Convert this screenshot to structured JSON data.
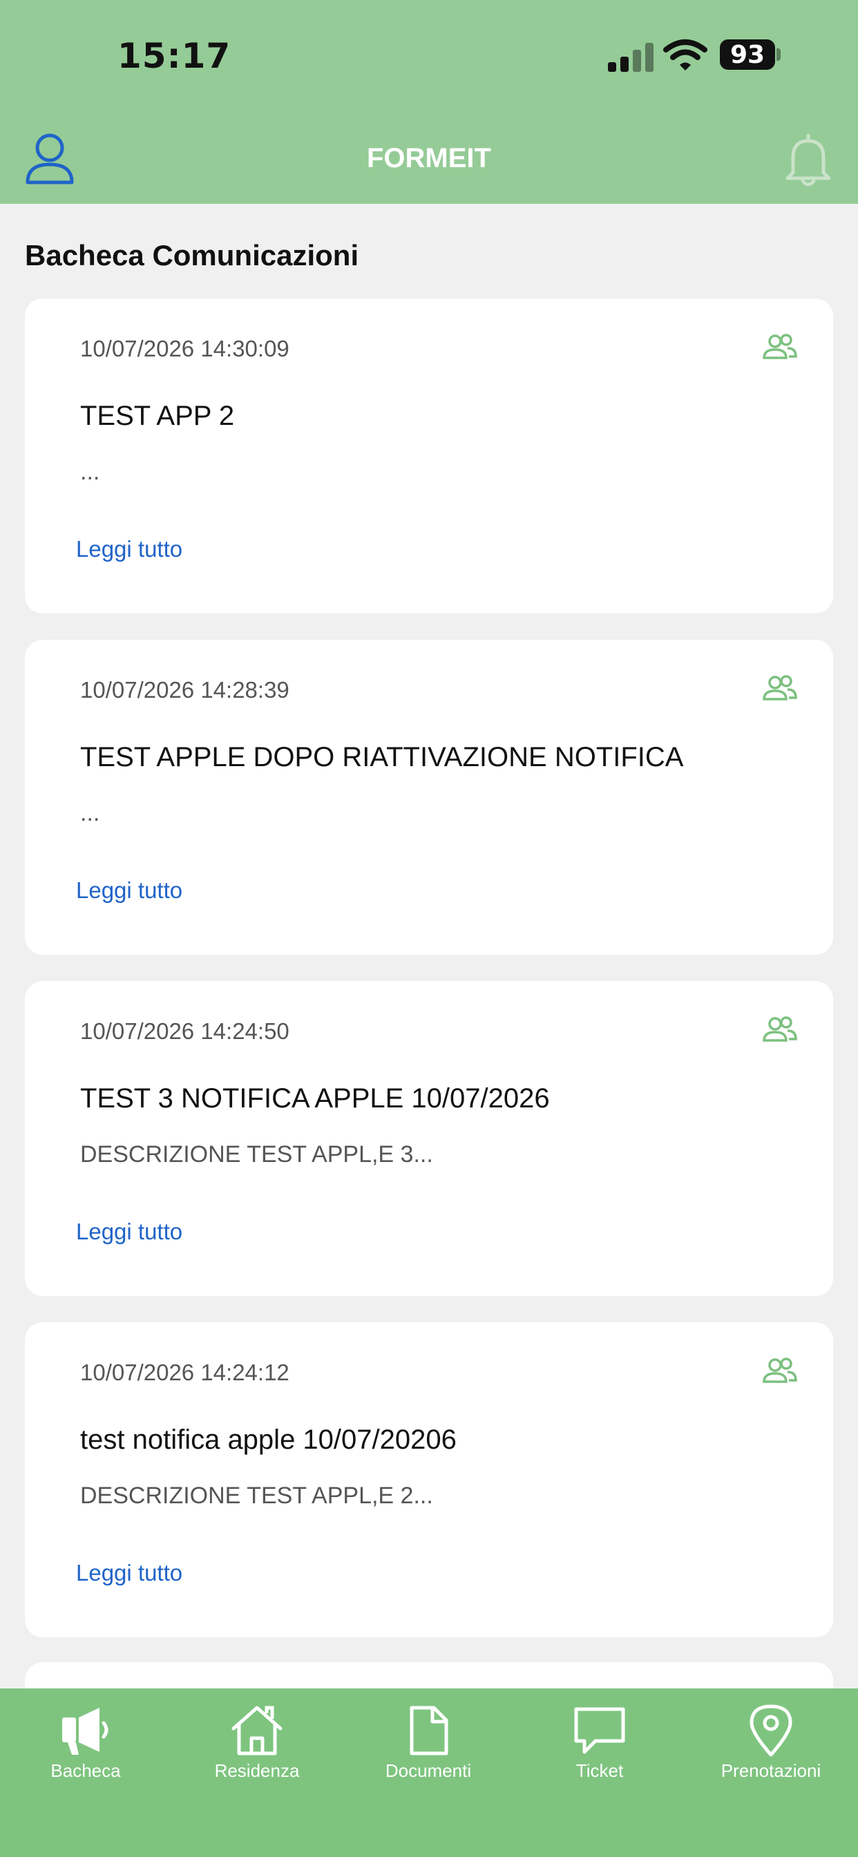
{
  "status_bar": {
    "time": "15:17",
    "battery": "93"
  },
  "header": {
    "title": "FORMEIT"
  },
  "section": {
    "title": "Bacheca Comunicazioni"
  },
  "cards": [
    {
      "date": "10/07/2026 14:30:09",
      "title": "TEST APP 2",
      "description": "...",
      "link": "Leggi tutto"
    },
    {
      "date": "10/07/2026 14:28:39",
      "title": "TEST APPLE DOPO RIATTIVAZIONE NOTIFICA",
      "description": "...",
      "link": "Leggi tutto"
    },
    {
      "date": "10/07/2026 14:24:50",
      "title": "TEST 3 NOTIFICA APPLE 10/07/2026",
      "description": "DESCRIZIONE TEST APPL,E 3...",
      "link": "Leggi tutto"
    },
    {
      "date": "10/07/2026 14:24:12",
      "title": "test notifica apple 10/07/20206",
      "description": "DESCRIZIONE TEST APPL,E 2...",
      "link": "Leggi tutto"
    }
  ],
  "tabs": [
    {
      "label": "Bacheca",
      "icon": "megaphone-icon"
    },
    {
      "label": "Residenza",
      "icon": "home-icon"
    },
    {
      "label": "Documenti",
      "icon": "document-icon"
    },
    {
      "label": "Ticket",
      "icon": "chat-bubble-icon"
    },
    {
      "label": "Prenotazioni",
      "icon": "location-pin-icon"
    }
  ],
  "colors": {
    "header": "#95cb97",
    "tabbar": "#7ec47f",
    "link": "#1f64c8",
    "icon_green": "#7cc07f",
    "profile_blue": "#1f64c8"
  }
}
